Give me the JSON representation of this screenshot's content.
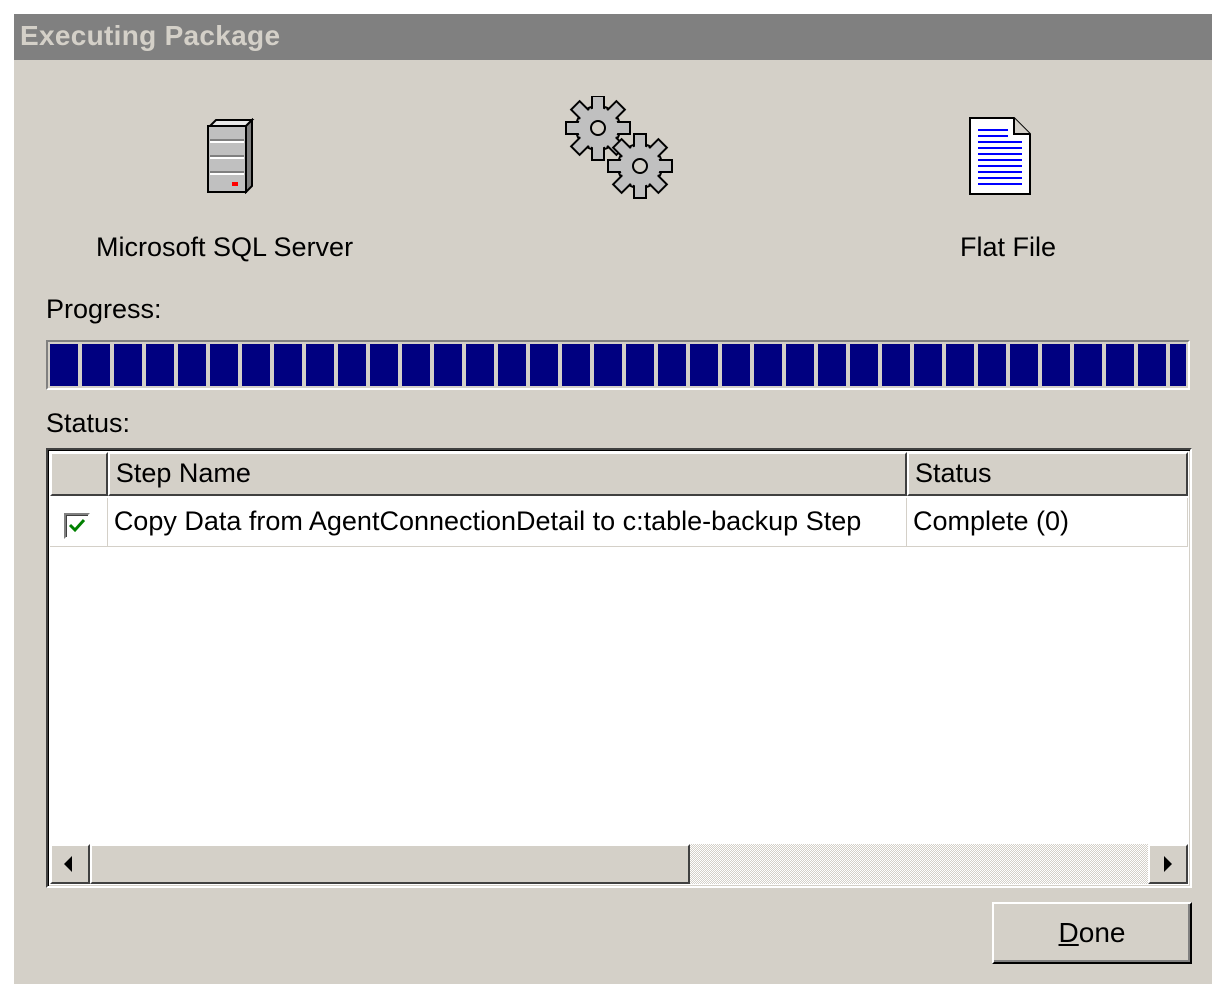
{
  "window": {
    "title": "Executing Package"
  },
  "source": {
    "label": "Microsoft SQL Server",
    "icon": "server-icon"
  },
  "transform": {
    "icon": "gears-icon"
  },
  "destination": {
    "label": "Flat File",
    "icon": "document-icon"
  },
  "progress": {
    "label": "Progress:",
    "value": 1.0,
    "color": "#000080"
  },
  "status": {
    "label": "Status:",
    "columns": [
      "",
      "Step Name",
      "Status"
    ],
    "rows": [
      {
        "checked": true,
        "step_name": "Copy Data from AgentConnectionDetail to c:table-backup Step",
        "status": "Complete (0)"
      }
    ]
  },
  "buttons": {
    "done_underlined": "D",
    "done_rest": "one"
  }
}
